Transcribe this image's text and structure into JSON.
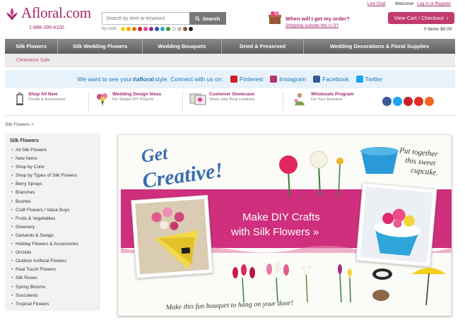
{
  "header": {
    "brand": "Afloral.com",
    "phone": "1-888-299-4100",
    "search_placeholder": "Search by item or keyword",
    "search_button": "Search",
    "by_color_label": "by color:",
    "color_swatches": [
      "#f2d400",
      "#f5a800",
      "#e0701a",
      "#d91a2a",
      "#e14a8c",
      "#8a2b8a",
      "#2b4fa8",
      "#27a2c7",
      "#3b9b3b",
      "#f4f4f0",
      "#bdbdbd",
      "#8c5a2b",
      "#222222"
    ],
    "when_label": "When will I get my order?",
    "ship_outside": "Shipping outside the U.S?",
    "live_chat": "Live Chat",
    "welcome": "Welcome!",
    "login": "Log In or Register",
    "cart_button": "View Cart / Checkout",
    "cart_icon": "chevron-right-icon",
    "items_count": "0 Items $0.00"
  },
  "nav": {
    "items": [
      "Silk Flowers",
      "Silk Wedding Flowers",
      "Wedding Bouquets",
      "Dried & Preserved",
      "Wedding Decorations & Floral Supplies"
    ],
    "clearance": "Clearance Sale"
  },
  "social": {
    "lead_1": "We want to see your ",
    "hashtag": "#afloral",
    "lead_2": " style. Connect with us on:",
    "networks": [
      {
        "label": "Pinterest",
        "color": "#cb2027"
      },
      {
        "label": "Instagram",
        "color": "#b4326d"
      },
      {
        "label": "Facebook",
        "color": "#3b5998"
      },
      {
        "label": "Twitter",
        "color": "#1da1f2"
      }
    ]
  },
  "features": [
    {
      "title": "Shop All New",
      "sub": "Florals & Accessories",
      "icon": "lantern-icon"
    },
    {
      "title": "Wedding Design Ideas",
      "sub": "For Simple DIY Projects",
      "icon": "bouquet-icon"
    },
    {
      "title": "Customer Showcase",
      "sub": "Share your floral creations",
      "icon": "photo-icon"
    },
    {
      "title": "Wholesale Program",
      "sub": "For Your Business",
      "icon": "person-icon"
    }
  ],
  "social_icons": [
    {
      "name": "facebook-icon",
      "color": "#3b5998"
    },
    {
      "name": "twitter-icon",
      "color": "#1da1f2"
    },
    {
      "name": "pinterest-icon",
      "color": "#cb2027"
    },
    {
      "name": "youtube-icon",
      "color": "#e52d27"
    },
    {
      "name": "rss-icon",
      "color": "#f26522"
    }
  ],
  "breadcrumb": "Silk Flowers >",
  "sidebar": {
    "heading": "Silk Flowers",
    "items": [
      "All Silk Flowers",
      "New Items",
      "Shop by Color",
      "Shop by Types of Silk Flowers",
      "Berry Sprays",
      "Branches",
      "Bushes",
      "Craft Flowers / Value Buys",
      "Fruits & Vegetables",
      "Greenery",
      "Garlands & Swags",
      "Holiday Flowers & Accessories",
      "Orchids",
      "Outdoor Artificial Flowers",
      "Real Touch Flowers",
      "Silk Roses",
      "Spring Blooms",
      "Succulents",
      "Tropical Flowers"
    ]
  },
  "hero": {
    "get": "Get",
    "creative": "Creative!",
    "headline_1": "Make DIY Crafts",
    "headline_2": "with Silk Flowers »",
    "put_together": "Put together",
    "this_sweet": "this sweet",
    "cupcake": "cupcake.",
    "bottom_note": "Make this fun bouquet to hang on your door!"
  },
  "colors": {
    "brand": "#a4266a",
    "nav": "#6f6f6f",
    "hero_banner": "#cf2f7c",
    "hero_blue": "#3a6db2"
  }
}
